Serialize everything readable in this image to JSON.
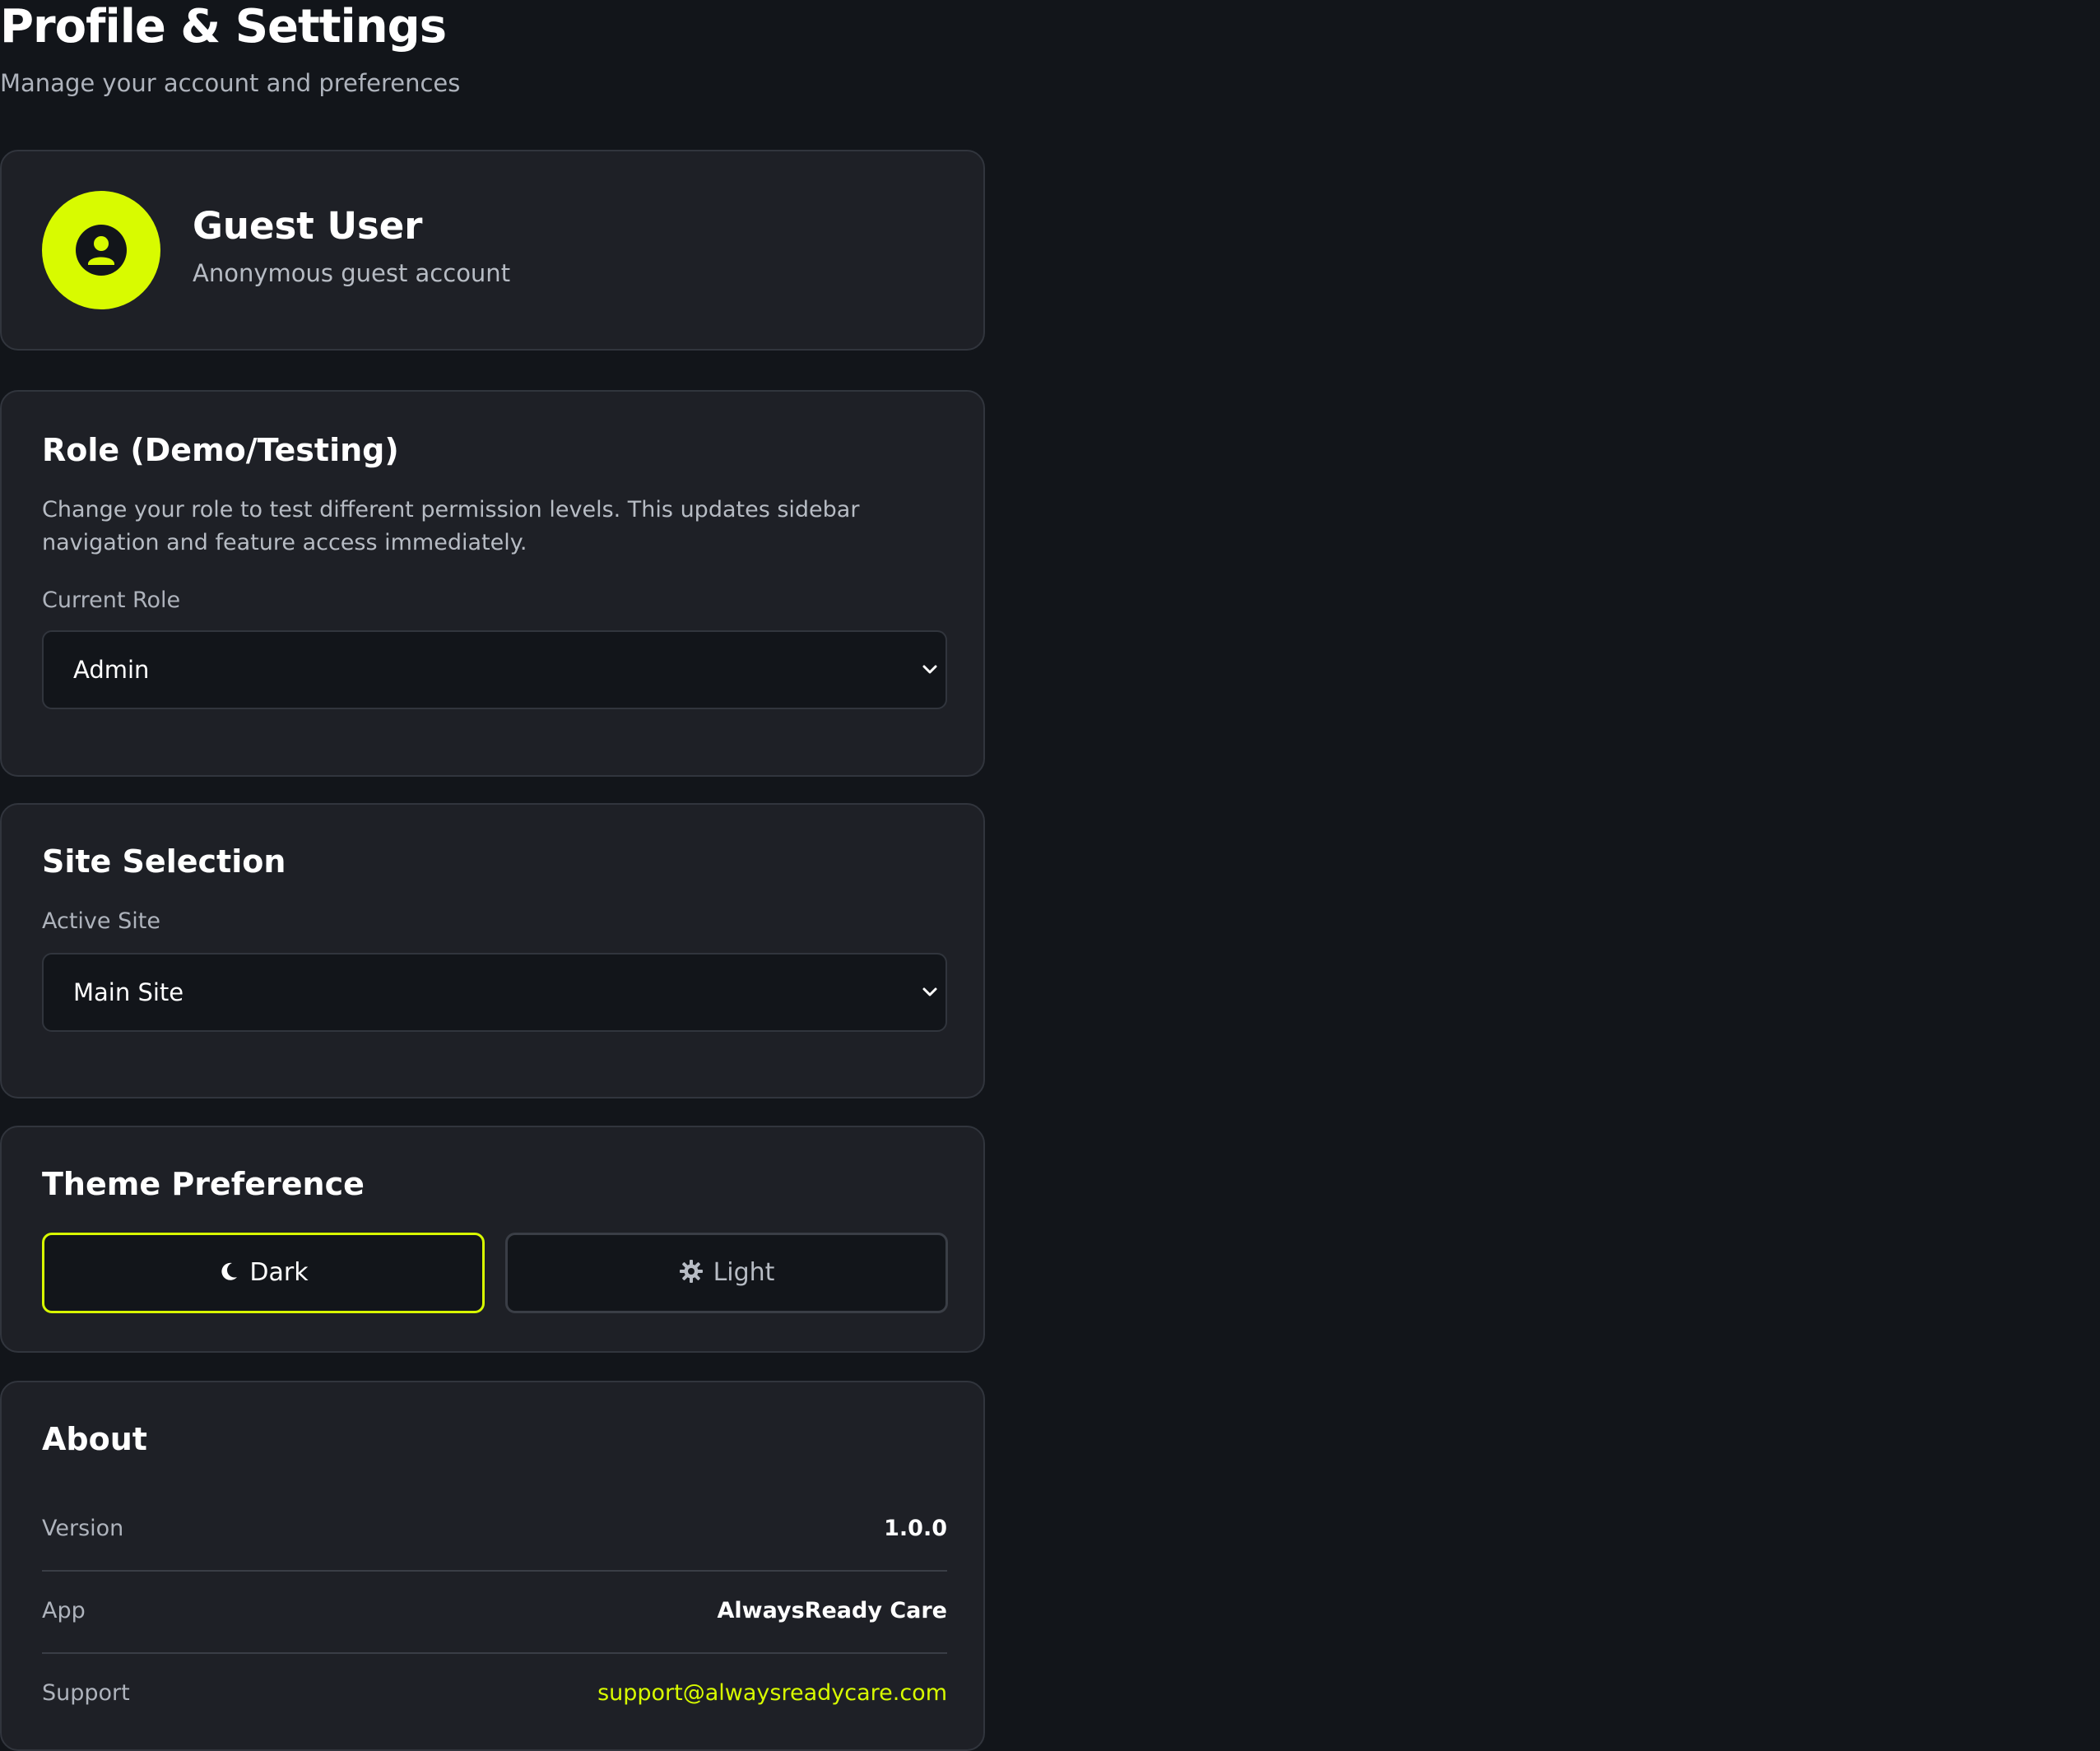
{
  "header": {
    "title": "Profile & Settings",
    "subtitle": "Manage your account and preferences"
  },
  "profile": {
    "avatar_icon": "user-circle-icon",
    "name": "Guest User",
    "description": "Anonymous guest account"
  },
  "role": {
    "heading": "Role (Demo/Testing)",
    "description": "Change your role to test different permission levels. This updates sidebar navigation and feature access immediately.",
    "field_label": "Current Role",
    "selected": "Admin"
  },
  "site": {
    "heading": "Site Selection",
    "field_label": "Active Site",
    "selected": "Main Site"
  },
  "theme": {
    "heading": "Theme Preference",
    "options": [
      {
        "label": "Dark",
        "icon": "moon-icon",
        "active": true
      },
      {
        "label": "Light",
        "icon": "gear-icon",
        "active": false
      }
    ]
  },
  "about": {
    "heading": "About",
    "rows": [
      {
        "key": "Version",
        "value": "1.0.0"
      },
      {
        "key": "App",
        "value": "AlwaysReady Care"
      },
      {
        "key": "Support",
        "value": "support@alwaysreadycare.com"
      }
    ]
  },
  "colors": {
    "background": "#12151a",
    "card": "#1e2026",
    "border": "#31353d",
    "accent": "#d8fb00",
    "muted_text": "#b7bcc4"
  }
}
